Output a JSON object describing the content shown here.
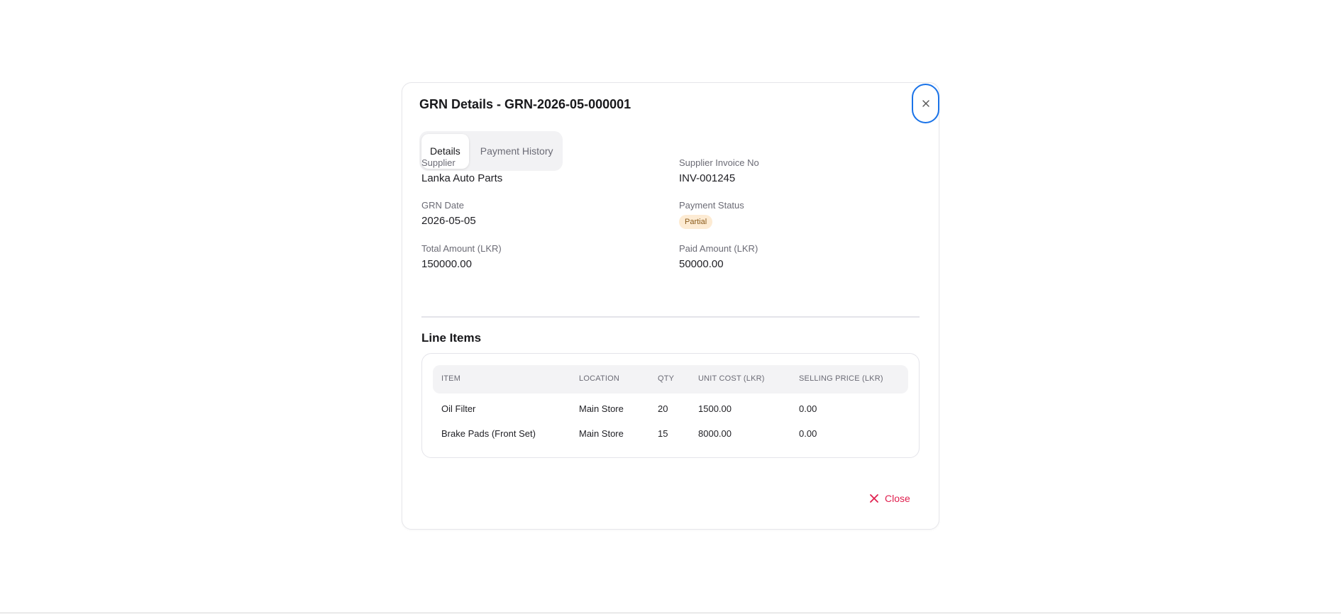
{
  "modal": {
    "title": "GRN Details - GRN-2026-05-000001",
    "tabs": [
      {
        "label": "Details"
      },
      {
        "label": "Payment History"
      }
    ],
    "fields": {
      "supplier": {
        "label": "Supplier",
        "value": "Lanka Auto Parts"
      },
      "supplier_invoice": {
        "label": "Supplier Invoice No",
        "value": "INV-001245"
      },
      "grn_date": {
        "label": "GRN Date",
        "value": "2026-05-05"
      },
      "payment_status": {
        "label": "Payment Status",
        "value": "Partial"
      },
      "total_amount": {
        "label": "Total Amount (LKR)",
        "value": "150000.00"
      },
      "paid_amount": {
        "label": "Paid Amount (LKR)",
        "value": "50000.00"
      }
    },
    "line_items": {
      "title": "Line Items",
      "columns": [
        "ITEM",
        "LOCATION",
        "QTY",
        "UNIT COST (LKR)",
        "SELLING PRICE (LKR)"
      ],
      "rows": [
        [
          "Oil Filter",
          "Main Store",
          "20",
          "1500.00",
          "0.00"
        ],
        [
          "Brake Pads (Front Set)",
          "Main Store",
          "15",
          "8000.00",
          "0.00"
        ]
      ]
    },
    "close_label": "Close"
  },
  "colors": {
    "accent_focus": "#1a73e8",
    "danger": "#e0204f",
    "badge_bg": "#fdebd3",
    "badge_text": "#8a5a1a"
  }
}
